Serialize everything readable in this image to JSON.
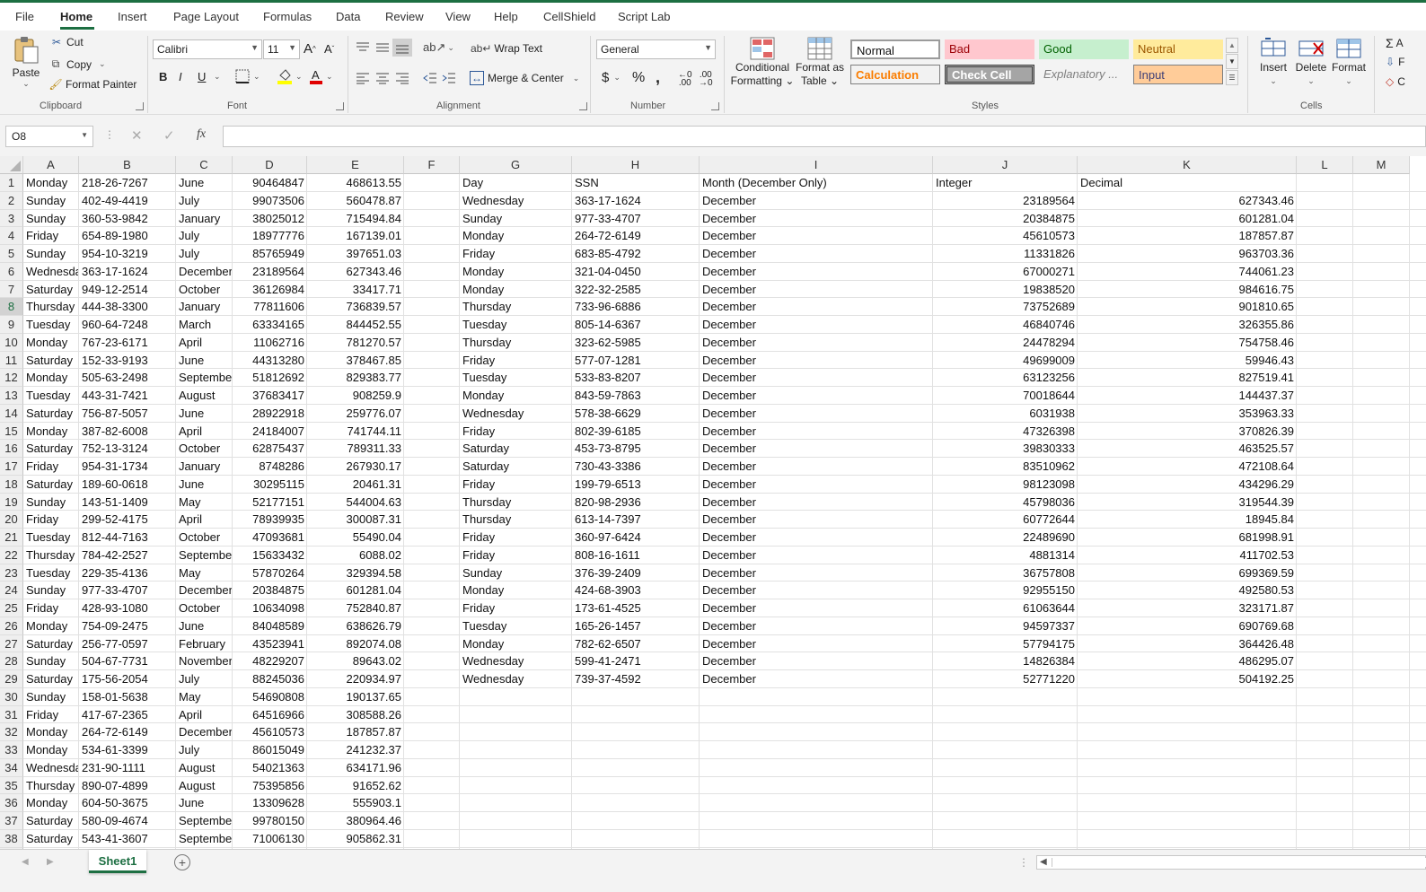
{
  "tabs": [
    "File",
    "Home",
    "Insert",
    "Page Layout",
    "Formulas",
    "Data",
    "Review",
    "View",
    "Help",
    "CellShield",
    "Script Lab"
  ],
  "active_tab": "Home",
  "ribbon": {
    "clipboard": {
      "paste": "Paste",
      "cut": "Cut",
      "copy": "Copy",
      "format_painter": "Format Painter",
      "label": "Clipboard"
    },
    "font": {
      "name": "Calibri",
      "size": "11",
      "bold": "B",
      "italic": "I",
      "underline": "U",
      "label": "Font"
    },
    "alignment": {
      "wrap_text": "Wrap Text",
      "merge_center": "Merge & Center",
      "label": "Alignment"
    },
    "number": {
      "format": "General",
      "label": "Number"
    },
    "styles": {
      "conditional_1": "Conditional",
      "conditional_2": "Formatting",
      "format_table_1": "Format as",
      "format_table_2": "Table",
      "cells": {
        "normal": "Normal",
        "bad": "Bad",
        "good": "Good",
        "neutral": "Neutral",
        "calculation": "Calculation",
        "check_cell": "Check Cell",
        "explanatory": "Explanatory ...",
        "input": "Input"
      },
      "label": "Styles"
    },
    "cells": {
      "insert": "Insert",
      "delete": "Delete",
      "format": "Format",
      "label": "Cells"
    },
    "editing": {
      "autosum": "A",
      "fill": "F",
      "clear": "C"
    }
  },
  "formula_bar": {
    "name_box": "O8",
    "fx": "fx",
    "content": ""
  },
  "columns": [
    "A",
    "B",
    "C",
    "D",
    "E",
    "F",
    "G",
    "H",
    "I",
    "J",
    "K",
    "L",
    "M"
  ],
  "right_header": {
    "day": "Day",
    "ssn": "SSN",
    "month": "Month (December Only)",
    "integer": "Integer",
    "decimal": "Decimal"
  },
  "rows_left": [
    [
      "Monday",
      "218-26-7267",
      "June",
      "90464847",
      "468613.55"
    ],
    [
      "Sunday",
      "402-49-4419",
      "July",
      "99073506",
      "560478.87"
    ],
    [
      "Sunday",
      "360-53-9842",
      "January",
      "38025012",
      "715494.84"
    ],
    [
      "Friday",
      "654-89-1980",
      "July",
      "18977776",
      "167139.01"
    ],
    [
      "Sunday",
      "954-10-3219",
      "July",
      "85765949",
      "397651.03"
    ],
    [
      "Wednesday",
      "363-17-1624",
      "December",
      "23189564",
      "627343.46"
    ],
    [
      "Saturday",
      "949-12-2514",
      "October",
      "36126984",
      "33417.71"
    ],
    [
      "Thursday",
      "444-38-3300",
      "January",
      "77811606",
      "736839.57"
    ],
    [
      "Tuesday",
      "960-64-7248",
      "March",
      "63334165",
      "844452.55"
    ],
    [
      "Monday",
      "767-23-6171",
      "April",
      "11062716",
      "781270.57"
    ],
    [
      "Saturday",
      "152-33-9193",
      "June",
      "44313280",
      "378467.85"
    ],
    [
      "Monday",
      "505-63-2498",
      "September",
      "51812692",
      "829383.77"
    ],
    [
      "Tuesday",
      "443-31-7421",
      "August",
      "37683417",
      "908259.9"
    ],
    [
      "Saturday",
      "756-87-5057",
      "June",
      "28922918",
      "259776.07"
    ],
    [
      "Monday",
      "387-82-6008",
      "April",
      "24184007",
      "741744.11"
    ],
    [
      "Saturday",
      "752-13-3124",
      "October",
      "62875437",
      "789311.33"
    ],
    [
      "Friday",
      "954-31-1734",
      "January",
      "8748286",
      "267930.17"
    ],
    [
      "Saturday",
      "189-60-0618",
      "June",
      "30295115",
      "20461.31"
    ],
    [
      "Sunday",
      "143-51-1409",
      "May",
      "52177151",
      "544004.63"
    ],
    [
      "Friday",
      "299-52-4175",
      "April",
      "78939935",
      "300087.31"
    ],
    [
      "Tuesday",
      "812-44-7163",
      "October",
      "47093681",
      "55490.04"
    ],
    [
      "Thursday",
      "784-42-2527",
      "September",
      "15633432",
      "6088.02"
    ],
    [
      "Tuesday",
      "229-35-4136",
      "May",
      "57870264",
      "329394.58"
    ],
    [
      "Sunday",
      "977-33-4707",
      "December",
      "20384875",
      "601281.04"
    ],
    [
      "Friday",
      "428-93-1080",
      "October",
      "10634098",
      "752840.87"
    ],
    [
      "Monday",
      "754-09-2475",
      "June",
      "84048589",
      "638626.79"
    ],
    [
      "Saturday",
      "256-77-0597",
      "February",
      "43523941",
      "892074.08"
    ],
    [
      "Sunday",
      "504-67-7731",
      "November",
      "48229207",
      "89643.02"
    ],
    [
      "Saturday",
      "175-56-2054",
      "July",
      "88245036",
      "220934.97"
    ],
    [
      "Sunday",
      "158-01-5638",
      "May",
      "54690808",
      "190137.65"
    ],
    [
      "Friday",
      "417-67-2365",
      "April",
      "64516966",
      "308588.26"
    ],
    [
      "Monday",
      "264-72-6149",
      "December",
      "45610573",
      "187857.87"
    ],
    [
      "Monday",
      "534-61-3399",
      "July",
      "86015049",
      "241232.37"
    ],
    [
      "Wednesday",
      "231-90-1111",
      "August",
      "54021363",
      "634171.96"
    ],
    [
      "Thursday",
      "890-07-4899",
      "August",
      "75395856",
      "91652.62"
    ],
    [
      "Monday",
      "604-50-3675",
      "June",
      "13309628",
      "555903.1"
    ],
    [
      "Saturday",
      "580-09-4674",
      "September",
      "99780150",
      "380964.46"
    ],
    [
      "Saturday",
      "543-41-3607",
      "September",
      "71006130",
      "905862.31"
    ]
  ],
  "rows_right": [
    [
      "Wednesday",
      "363-17-1624",
      "December",
      "23189564",
      "627343.46"
    ],
    [
      "Sunday",
      "977-33-4707",
      "December",
      "20384875",
      "601281.04"
    ],
    [
      "Monday",
      "264-72-6149",
      "December",
      "45610573",
      "187857.87"
    ],
    [
      "Friday",
      "683-85-4792",
      "December",
      "11331826",
      "963703.36"
    ],
    [
      "Monday",
      "321-04-0450",
      "December",
      "67000271",
      "744061.23"
    ],
    [
      "Monday",
      "322-32-2585",
      "December",
      "19838520",
      "984616.75"
    ],
    [
      "Thursday",
      "733-96-6886",
      "December",
      "73752689",
      "901810.65"
    ],
    [
      "Tuesday",
      "805-14-6367",
      "December",
      "46840746",
      "326355.86"
    ],
    [
      "Thursday",
      "323-62-5985",
      "December",
      "24478294",
      "754758.46"
    ],
    [
      "Friday",
      "577-07-1281",
      "December",
      "49699009",
      "59946.43"
    ],
    [
      "Tuesday",
      "533-83-8207",
      "December",
      "63123256",
      "827519.41"
    ],
    [
      "Monday",
      "843-59-7863",
      "December",
      "70018644",
      "144437.37"
    ],
    [
      "Wednesday",
      "578-38-6629",
      "December",
      "6031938",
      "353963.33"
    ],
    [
      "Friday",
      "802-39-6185",
      "December",
      "47326398",
      "370826.39"
    ],
    [
      "Saturday",
      "453-73-8795",
      "December",
      "39830333",
      "463525.57"
    ],
    [
      "Saturday",
      "730-43-3386",
      "December",
      "83510962",
      "472108.64"
    ],
    [
      "Friday",
      "199-79-6513",
      "December",
      "98123098",
      "434296.29"
    ],
    [
      "Thursday",
      "820-98-2936",
      "December",
      "45798036",
      "319544.39"
    ],
    [
      "Thursday",
      "613-14-7397",
      "December",
      "60772644",
      "18945.84"
    ],
    [
      "Friday",
      "360-97-6424",
      "December",
      "22489690",
      "681998.91"
    ],
    [
      "Friday",
      "808-16-1611",
      "December",
      "4881314",
      "411702.53"
    ],
    [
      "Sunday",
      "376-39-2409",
      "December",
      "36757808",
      "699369.59"
    ],
    [
      "Monday",
      "424-68-3903",
      "December",
      "92955150",
      "492580.53"
    ],
    [
      "Friday",
      "173-61-4525",
      "December",
      "61063644",
      "323171.87"
    ],
    [
      "Tuesday",
      "165-26-1457",
      "December",
      "94597337",
      "690769.68"
    ],
    [
      "Monday",
      "782-62-6507",
      "December",
      "57794175",
      "364426.48"
    ],
    [
      "Wednesday",
      "599-41-2471",
      "December",
      "14826384",
      "486295.07"
    ],
    [
      "Wednesday",
      "739-37-4592",
      "December",
      "52771220",
      "504192.25"
    ]
  ],
  "selected_row": 8,
  "sheet_tab": "Sheet1",
  "colors": {
    "accent": "#1d6f42"
  }
}
